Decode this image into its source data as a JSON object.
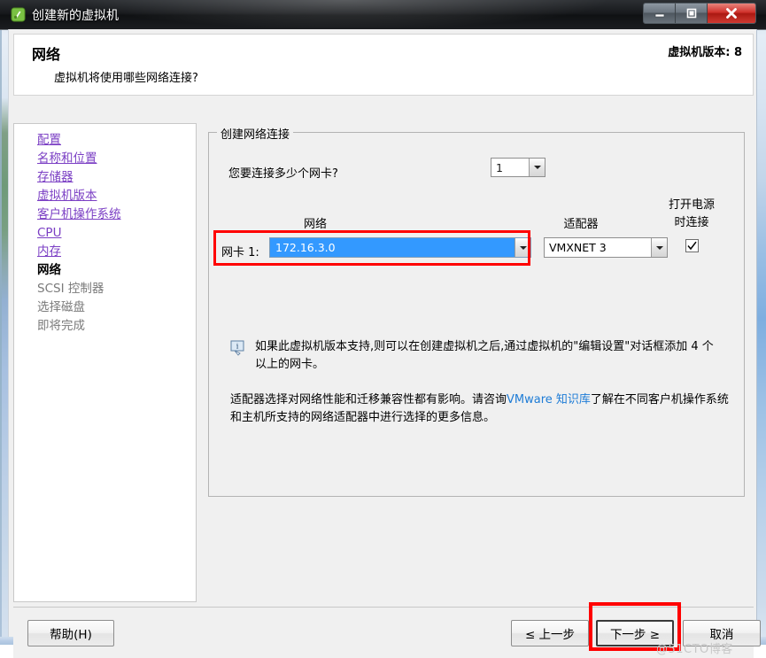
{
  "window": {
    "title": "创建新的虚拟机",
    "icon": "vm-wizard-icon",
    "buttons": {
      "minimize": "minimize-icon",
      "maximize": "maximize-icon",
      "close": "close-icon"
    }
  },
  "header": {
    "title": "网络",
    "subtitle": "虚拟机将使用哪些网络连接?",
    "version": "虚拟机版本: 8"
  },
  "sidebar": {
    "items": [
      {
        "label": "配置",
        "state": "link"
      },
      {
        "label": "名称和位置",
        "state": "link"
      },
      {
        "label": "存储器",
        "state": "link"
      },
      {
        "label": "虚拟机版本",
        "state": "link"
      },
      {
        "label": "客户机操作系统",
        "state": "link"
      },
      {
        "label": "CPU",
        "state": "link"
      },
      {
        "label": "内存",
        "state": "link"
      },
      {
        "label": "网络",
        "state": "current"
      },
      {
        "label": "SCSI 控制器",
        "state": "disabled"
      },
      {
        "label": "选择磁盘",
        "state": "disabled"
      },
      {
        "label": "即将完成",
        "state": "disabled"
      }
    ]
  },
  "main": {
    "groupbox_legend": "创建网络连接",
    "nic_count_label": "您要连接多少个网卡?",
    "nic_count_value": "1",
    "columns": {
      "network": "网络",
      "adapter": "适配器",
      "connect_at_power_on_line1": "打开电源",
      "connect_at_power_on_line2": "时连接"
    },
    "row": {
      "label": "网卡 1:",
      "network_value": "172.16.3.0",
      "adapter_value": "VMXNET 3",
      "connect_checked": true
    },
    "tip_text": "如果此虚拟机版本支持,则可以在创建虚拟机之后,通过虚拟机的\"编辑设置\"对话框添加 4 个以上的网卡。",
    "tip_icon": "info-tip-icon",
    "paragraph2_before": "适配器选择对网络性能和迁移兼容性都有影响。请咨询",
    "paragraph2_link": "VMware 知识库",
    "paragraph2_after": "了解在不同客户机操作系统和主机所支持的网络适配器中进行选择的更多信息。"
  },
  "footer": {
    "help": "帮助(H)",
    "back": "≤ 上一步",
    "next": "下一步 ≥",
    "cancel": "取消"
  },
  "watermark": "@51CTO博客",
  "colors": {
    "link": "#7b3fc4",
    "selection": "#3399ff",
    "annotation": "#ff0000",
    "kb_link": "#1e7cd6"
  }
}
